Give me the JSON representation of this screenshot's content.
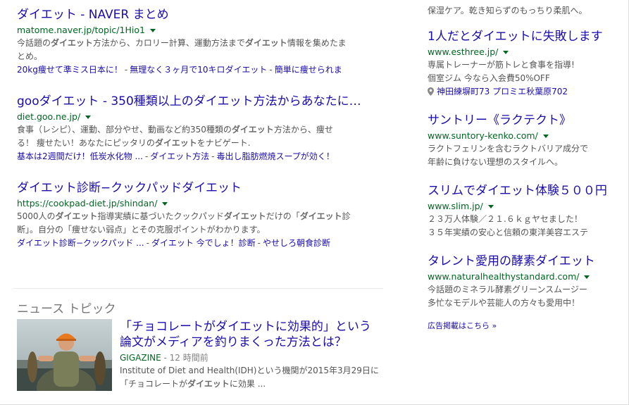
{
  "organic": [
    {
      "title": "ダイエット - NAVER まとめ",
      "url": "matome.naver.jp/topic/1Hio1",
      "snippet_lines": [
        [
          {
            "t": "今話題の"
          },
          {
            "t": "ダイエット",
            "b": true
          },
          {
            "t": "方法から、カロリー計算、運動方法まで"
          },
          {
            "t": "ダイエット",
            "b": true
          },
          {
            "t": "情報を集めたま"
          }
        ],
        [
          {
            "t": "とめ。"
          }
        ]
      ],
      "sitelinks": [
        "20kg痩せて準ミス日本に！",
        "無理なく３ヶ月で10キロダイエット",
        "簡単に痩せられま"
      ]
    },
    {
      "title": "gooダイエット - 350種類以上のダイエット方法からあなたに…",
      "url": "diet.goo.ne.jp/",
      "snippet_lines": [
        [
          {
            "t": "食事（レシピ）、運動、部分やせ、動画など約350種類の"
          },
          {
            "t": "ダイエット",
            "b": true
          },
          {
            "t": "方法から、痩せ"
          }
        ],
        [
          {
            "t": "る！ 痩せたい！あなたにピッタリの"
          },
          {
            "t": "ダイエット",
            "b": true
          },
          {
            "t": "をナビゲート."
          }
        ]
      ],
      "sitelinks": [
        "基本は2週間だけ！低炭水化物 ...",
        "ダイエット方法",
        "毒出し脂肪燃焼スープが効く！"
      ]
    },
    {
      "title": "ダイエット診断−クックパッドダイエット",
      "url": "https://cookpad-diet.jp/shindan/",
      "snippet_lines": [
        [
          {
            "t": "5000人の"
          },
          {
            "t": "ダイエット",
            "b": true
          },
          {
            "t": "指導実績に基づいたクックパッド"
          },
          {
            "t": "ダイエット",
            "b": true
          },
          {
            "t": "だけの「"
          },
          {
            "t": "ダイエット",
            "b": true
          },
          {
            "t": "診"
          }
        ],
        [
          {
            "t": "断」。自分の「痩せない弱点」とその克服ポイントがわかります。"
          }
        ]
      ],
      "sitelinks": [
        "ダイエット診断−クックパッド ...",
        "ダイエット 今でしょ！診断",
        "やせしろ朝食診断"
      ]
    }
  ],
  "news": {
    "heading": "ニュース トピック",
    "title": "「チョコレートがダイエットに効果的」という論文がメディアを釣りまくった方法とは？",
    "publisher": "GIGAZINE",
    "time": "12 時間前",
    "snippet_lines": [
      [
        {
          "t": "Institute of Diet and Health(IDH)という機関が2015年3月29日に"
        }
      ],
      [
        {
          "t": "「チョコレートが"
        },
        {
          "t": "ダイエット",
          "b": true
        },
        {
          "t": "に効果 ..."
        }
      ]
    ]
  },
  "ads_top_snippet": "保湿ケア。乾き知らずのもっちり柔肌へ。",
  "ads": [
    {
      "title": "1人だとダイエットに失敗します",
      "url": "www.esthree.jp/",
      "lines": [
        "専属トレーナーが筋トレと食事を指導!",
        "個室ジム 今なら入会費50%OFF"
      ],
      "address": "神田練塀町73 プロミエ秋葉原702"
    },
    {
      "title": "サントリー《ラクテクト》",
      "url": "www.suntory-kenko.com/",
      "lines": [
        "ラクトフェリンを含むラクトバリア成分で",
        "年齢に負けない理想のスタイルへ。"
      ]
    },
    {
      "title": "スリムでダイエット体験５００円",
      "url": "www.slim.jp/",
      "lines": [
        "２３万人体験／２１.６ｋｇヤセました！",
        "３５年実績の安心と信頼の東洋美容エステ"
      ]
    },
    {
      "title": "タレント愛用の酵素ダイエット",
      "url": "www.naturalhealthystandard.com/",
      "lines": [
        "今話題のミネラル酵素グリーンスムージー",
        "多忙なモデルや芸能人の方々も愛用中！"
      ]
    }
  ],
  "ads_footer": "広告掲載はこちら »",
  "colors": {
    "link": "#1a0dab",
    "url": "#006621",
    "snippet": "#545454"
  }
}
